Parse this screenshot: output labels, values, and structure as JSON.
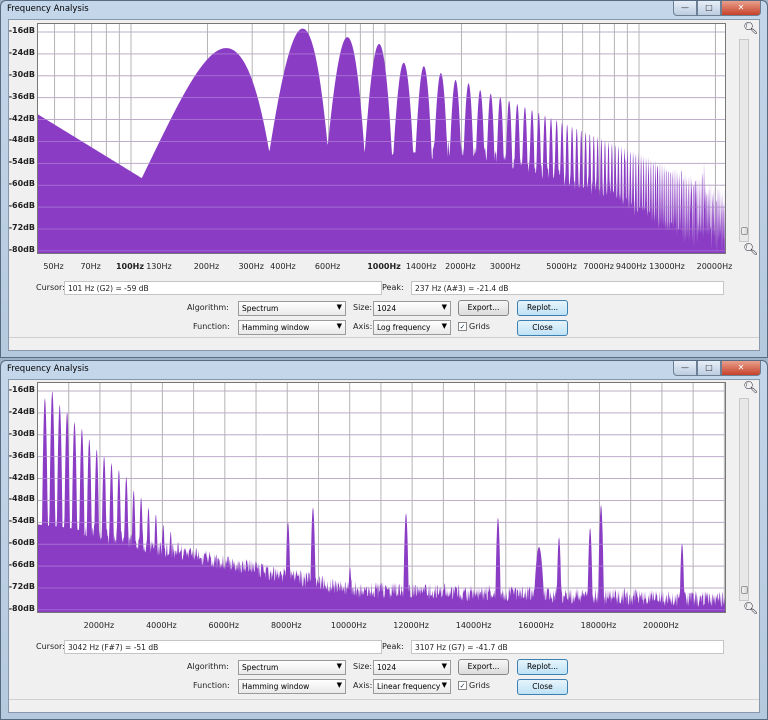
{
  "windows": [
    {
      "title": "Frequency Analysis",
      "cursor_label": "Cursor:",
      "cursor_value": "101 Hz (G2) = -59 dB",
      "peak_label": "Peak:",
      "peak_value": "237 Hz (A#3) = -21.4 dB",
      "algorithm_label": "Algorithm:",
      "algorithm_value": "Spectrum",
      "size_label": "Size:",
      "size_value": "1024",
      "export_label": "Export...",
      "replot_label": "Replot...",
      "function_label": "Function:",
      "function_value": "Hamming window",
      "axis_label": "Axis:",
      "axis_value": "Log frequency",
      "grids_label": "Grids",
      "grids_checked": true,
      "close_label": "Close"
    },
    {
      "title": "Frequency Analysis",
      "cursor_label": "Cursor:",
      "cursor_value": "3042 Hz (F#7) = -51 dB",
      "peak_label": "Peak:",
      "peak_value": "3107 Hz (G7) = -41.7 dB",
      "algorithm_label": "Algorithm:",
      "algorithm_value": "Spectrum",
      "size_label": "Size:",
      "size_value": "1024",
      "export_label": "Export...",
      "replot_label": "Replot...",
      "function_label": "Function:",
      "function_value": "Hamming window",
      "axis_label": "Axis:",
      "axis_value": "Linear frequency",
      "grids_label": "Grids",
      "grids_checked": true,
      "close_label": "Close"
    }
  ],
  "window_buttons": {
    "minimize": "—",
    "maximize": "□",
    "close": "✕"
  },
  "colors": {
    "spectrum": "#8a3dc4",
    "grid": "#b4b4b4"
  },
  "chart_data": [
    {
      "type": "area",
      "title": "Frequency Analysis",
      "xscale": "log",
      "xlim": [
        35,
        22050
      ],
      "ylim": [
        -80,
        -16
      ],
      "ylabel_ticks": [
        "-16dB",
        "-24dB",
        "-30dB",
        "-36dB",
        "-42dB",
        "-48dB",
        "-54dB",
        "-60dB",
        "-66dB",
        "-72dB",
        "-80dB"
      ],
      "ytick_values": [
        -16,
        -22.4,
        -28.8,
        -35.2,
        -41.6,
        -48,
        -54.4,
        -60.8,
        -67.2,
        -73.6,
        -80
      ],
      "xtick_labels": [
        {
          "f": 50,
          "label": "50Hz"
        },
        {
          "f": 70,
          "label": "70Hz"
        },
        {
          "f": 100,
          "label": "100Hz",
          "bold": true
        },
        {
          "f": 130,
          "label": "130Hz"
        },
        {
          "f": 200,
          "label": "200Hz"
        },
        {
          "f": 300,
          "label": "300Hz"
        },
        {
          "f": 400,
          "label": "400Hz"
        },
        {
          "f": 600,
          "label": "600Hz"
        },
        {
          "f": 1000,
          "label": "1000Hz",
          "bold": true
        },
        {
          "f": 1400,
          "label": "1400Hz"
        },
        {
          "f": 2000,
          "label": "2000Hz"
        },
        {
          "f": 3000,
          "label": "3000Hz"
        },
        {
          "f": 5000,
          "label": "5000Hz"
        },
        {
          "f": 7000,
          "label": "7000Hz"
        },
        {
          "f": 9400,
          "label": "9400Hz"
        },
        {
          "f": 13000,
          "label": "13000Hz"
        },
        {
          "f": 20000,
          "label": "20000Hz"
        }
      ],
      "grid": true,
      "fundamental_hz": 237,
      "harmonic_peaks_db": [
        -20.7,
        -15,
        -17.5,
        -19.5,
        -25,
        -26,
        -28,
        -30,
        -31,
        -33,
        -34,
        -35
      ],
      "floor_db": [
        [
          35,
          -36
        ],
        [
          130,
          -62
        ],
        [
          300,
          -64
        ],
        [
          700,
          -58
        ],
        [
          1000,
          -52
        ],
        [
          2000,
          -50
        ],
        [
          4000,
          -56
        ],
        [
          8000,
          -64
        ],
        [
          15000,
          -76
        ],
        [
          22050,
          -79
        ]
      ],
      "tones": [
        [
          8024,
          -56
        ],
        [
          8824,
          -52
        ],
        [
          10010,
          -68
        ],
        [
          11804,
          -54
        ],
        [
          14750,
          -56
        ],
        [
          16064,
          -62
        ],
        [
          16705,
          -59
        ],
        [
          17700,
          -57
        ],
        [
          18050,
          -52
        ],
        [
          20645,
          -61
        ]
      ]
    },
    {
      "type": "area",
      "title": "Frequency Analysis",
      "xscale": "linear",
      "xlim": [
        0,
        22000
      ],
      "ylim": [
        -80,
        -16
      ],
      "ylabel_ticks": [
        "-16dB",
        "-24dB",
        "-30dB",
        "-36dB",
        "-42dB",
        "-48dB",
        "-54dB",
        "-60dB",
        "-66dB",
        "-72dB",
        "-80dB"
      ],
      "ytick_values": [
        -16,
        -22.4,
        -28.8,
        -35.2,
        -41.6,
        -48,
        -54.4,
        -60.8,
        -67.2,
        -73.6,
        -80
      ],
      "xtick_labels": [
        {
          "f": 2000,
          "label": "2000Hz"
        },
        {
          "f": 4000,
          "label": "4000Hz"
        },
        {
          "f": 6000,
          "label": "6000Hz"
        },
        {
          "f": 8000,
          "label": "8000Hz"
        },
        {
          "f": 10000,
          "label": "10000Hz"
        },
        {
          "f": 12000,
          "label": "12000Hz"
        },
        {
          "f": 14000,
          "label": "14000Hz"
        },
        {
          "f": 16000,
          "label": "16000Hz"
        },
        {
          "f": 18000,
          "label": "18000Hz"
        },
        {
          "f": 20000,
          "label": "20000Hz"
        }
      ],
      "grid": true,
      "fundamental_hz": 237,
      "harmonic_peaks_db": [
        -18,
        -16,
        -20,
        -22,
        -25,
        -27,
        -30,
        -33,
        -35,
        -37,
        -39,
        -41,
        -45,
        -47,
        -50,
        -52,
        -55,
        -57,
        -60,
        -62,
        -65,
        -67
      ],
      "floor_db": [
        [
          0,
          -55
        ],
        [
          1000,
          -56
        ],
        [
          3000,
          -60
        ],
        [
          5000,
          -64
        ],
        [
          8000,
          -70
        ],
        [
          10000,
          -74
        ],
        [
          22000,
          -77
        ]
      ],
      "tones": [
        [
          8024,
          -54.3
        ],
        [
          8824,
          -50
        ],
        [
          10010,
          -67.5
        ],
        [
          11804,
          -51.7
        ],
        [
          14750,
          -53
        ],
        [
          16064,
          -61.6
        ],
        [
          16705,
          -58.7
        ],
        [
          17700,
          -56
        ],
        [
          18050,
          -49.3
        ],
        [
          20645,
          -60.5
        ]
      ]
    }
  ]
}
